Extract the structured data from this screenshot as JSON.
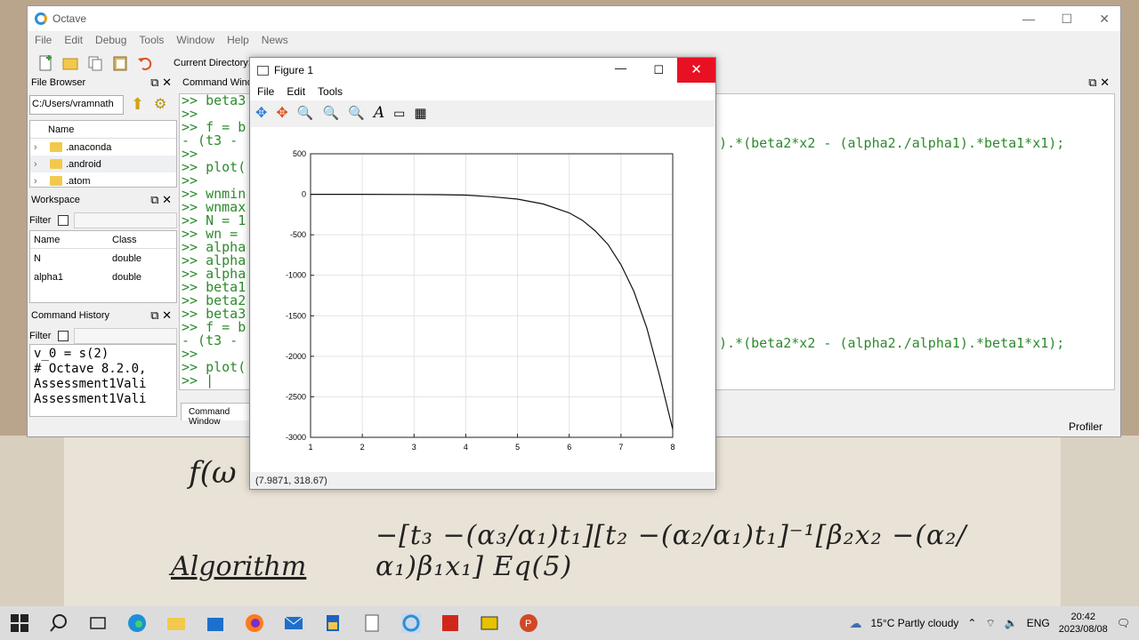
{
  "octave": {
    "title": "Octave",
    "menu": [
      "File",
      "Edit",
      "Debug",
      "Tools",
      "Window",
      "Help",
      "News"
    ],
    "current_directory_label": "Current Directory:",
    "file_browser": {
      "title": "File Browser",
      "path": "C:/Users/vramnath",
      "column": "Name",
      "items": [
        ".anaconda",
        ".android",
        ".atom"
      ]
    },
    "workspace": {
      "title": "Workspace",
      "filter_label": "Filter",
      "columns": [
        "Name",
        "Class"
      ],
      "rows": [
        {
          "name": "N",
          "class": "double"
        },
        {
          "name": "alpha1",
          "class": "double"
        }
      ]
    },
    "history": {
      "title": "Command History",
      "filter_label": "Filter",
      "lines": [
        "v_0 = s(2)",
        "# Octave 8.2.0,",
        "Assessment1Vali",
        "Assessment1Vali"
      ]
    },
    "command_window": {
      "title": "Command Window",
      "tab_label": "Command Window",
      "lines": [
        ">> beta3",
        ">>",
        ">> f = b",
        "- (t3 -",
        ">>",
        ">> plot(",
        ">>",
        ">> wnmin",
        ">> wnmax",
        ">> N = 1",
        ">> wn =",
        ">> alpha",
        ">> alpha",
        ">> alpha",
        ">> beta1",
        ">> beta2",
        ">> beta3",
        ">> f = b",
        "- (t3 -",
        ">>",
        ">> plot(",
        ">> |"
      ],
      "right_text_1": ").*(beta2*x2 - (alpha2./alpha1).*beta1*x1);",
      "right_text_2": ").*(beta2*x2 - (alpha2./alpha1).*beta1*x1);"
    },
    "profiler_label": "Profiler"
  },
  "figure": {
    "title": "Figure 1",
    "menu": [
      "File",
      "Edit",
      "Tools"
    ],
    "status": "(7.9871, 318.67)",
    "colors": {
      "curve": "#111111",
      "grid": "#e3e3e3"
    }
  },
  "chart_data": {
    "type": "line",
    "x_ticks": [
      1,
      2,
      3,
      4,
      5,
      6,
      7,
      8
    ],
    "y_ticks": [
      500,
      0,
      -500,
      -1000,
      -1500,
      -2000,
      -2500,
      -3000
    ],
    "xlim": [
      1,
      8
    ],
    "ylim": [
      -3000,
      500
    ],
    "grid": true,
    "x": [
      1,
      2,
      3,
      3.5,
      4,
      4.5,
      5,
      5.5,
      6,
      6.25,
      6.5,
      6.75,
      7,
      7.25,
      7.5,
      7.75,
      8
    ],
    "y": [
      0,
      0,
      -2,
      -5,
      -10,
      -30,
      -60,
      -120,
      -230,
      -320,
      -450,
      -620,
      -870,
      -1200,
      -1650,
      -2250,
      -2900
    ]
  },
  "paper": {
    "eq_left": "f(ω",
    "eq_mid": "−[t₃ −(α₃/α₁)t₁][t₂ −(α₂/α₁)t₁]⁻¹[β₂x₂ −(α₂/α₁)β₁x₁]   Eq(5)",
    "algorithm": "Algorithm"
  },
  "taskbar": {
    "weather": "15°C  Partly cloudy",
    "language": "ENG",
    "time": "20:42",
    "date": "2023/08/08"
  }
}
